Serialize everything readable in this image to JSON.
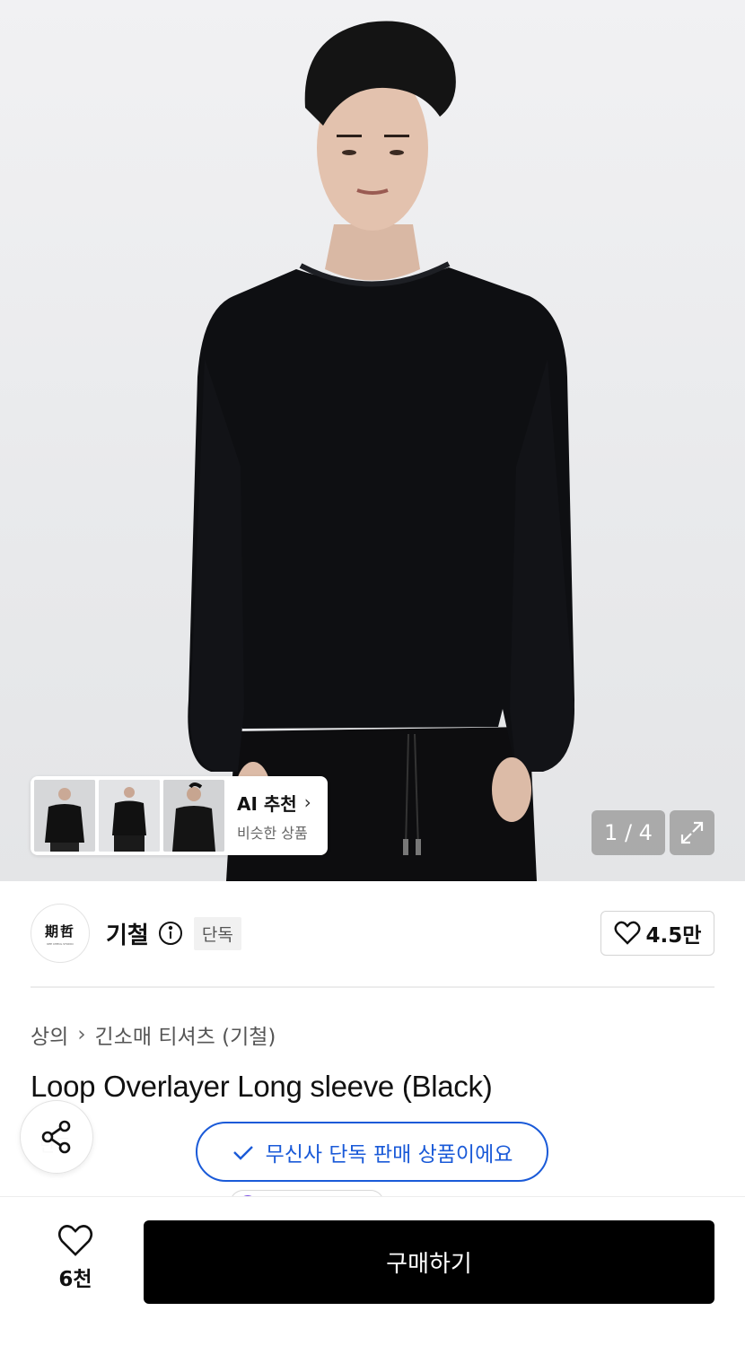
{
  "gallery": {
    "ai_card": {
      "title": "AI 추천",
      "subtitle": "비슷한 상품"
    },
    "pager": "1 / 4"
  },
  "brand": {
    "logo_text": "期哲",
    "logo_subtext": "KEE CHEOL STUDIO",
    "name": "기철",
    "badge": "단독",
    "likes": "4.5만"
  },
  "breadcrumb": {
    "category": "상의",
    "subcategory": "긴소매 티셔츠 (기철)"
  },
  "product": {
    "title": "Loop Overlayer Long sleeve (Black)",
    "badge": "단독",
    "exclusive_notice": "무신사 단독 판매 상품이에요"
  },
  "bottom_bar": {
    "wish_count": "6천",
    "buy_label": "구매하기"
  },
  "colors": {
    "accent_blue": "#1a5ad8",
    "buy_button": "#000000"
  }
}
